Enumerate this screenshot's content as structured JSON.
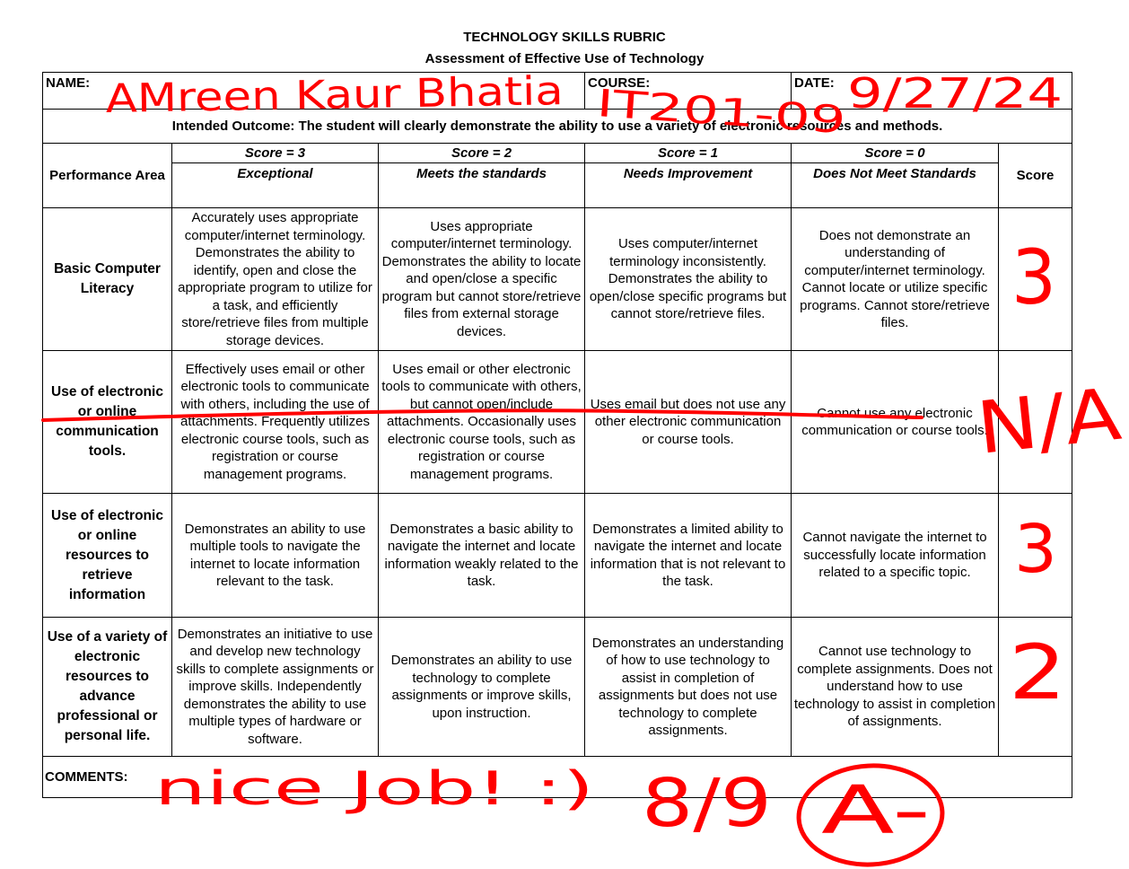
{
  "header": {
    "title": "TECHNOLOGY SKILLS RUBRIC",
    "subtitle": "Assessment of Effective Use of Technology",
    "name_label": "NAME:",
    "course_label": "COURSE:",
    "date_label": "DATE:"
  },
  "outcome": "Intended Outcome:  The student will clearly demonstrate the ability to use a variety of electronic resources and methods.",
  "columns": {
    "performance_area": "Performance Area",
    "score_header": "Score",
    "levels": [
      {
        "score": "Score = 3",
        "label": "Exceptional"
      },
      {
        "score": "Score = 2",
        "label": "Meets the standards"
      },
      {
        "score": "Score = 1",
        "label": "Needs Improvement"
      },
      {
        "score": "Score = 0",
        "label": "Does Not Meet Standards"
      }
    ]
  },
  "rows": [
    {
      "area": "Basic Computer Literacy",
      "cells": [
        "Accurately uses appropriate computer/internet terminology. Demonstrates the ability to identify, open and close the appropriate program to utilize for a task, and efficiently store/retrieve files from multiple storage devices.",
        "Uses appropriate computer/internet terminology. Demonstrates the ability to locate and open/close a specific program but cannot store/retrieve files from external storage devices.",
        "Uses computer/internet terminology inconsistently. Demonstrates the ability to open/close specific programs but cannot store/retrieve files.",
        "Does not demonstrate an understanding of computer/internet terminology. Cannot locate or utilize specific programs.  Cannot store/retrieve files."
      ]
    },
    {
      "area": "Use of electronic or online communication tools.",
      "cells": [
        "Effectively uses email or other electronic tools to communicate with others, including the use of attachments.  Frequently utilizes electronic course tools, such as registration or course management programs.",
        "Uses email or other electronic tools to communicate with others, but cannot open/include attachments.  Occasionally uses electronic course tools, such as registration or course management programs.",
        "Uses email but does not use any other electronic communication or course tools.",
        "Cannot use any electronic communication or course tools."
      ]
    },
    {
      "area": "Use of electronic or online resources to retrieve information",
      "cells": [
        "Demonstrates an ability to use multiple tools to navigate the internet to locate information relevant to the task.",
        "Demonstrates a basic ability to navigate the internet and locate information weakly related to the task.",
        "Demonstrates a limited ability to navigate the internet and locate information that is not relevant to the task.",
        "Cannot navigate the internet to successfully locate information related to a specific topic."
      ]
    },
    {
      "area": "Use of a variety of electronic resources to advance professional or personal life.",
      "cells": [
        "Demonstrates an initiative to use and develop new technology skills to complete assignments or improve skills.  Independently demonstrates the ability to use multiple types of hardware or software.",
        "Demonstrates an ability to use technology to complete assignments or improve skills, upon instruction.",
        "Demonstrates an understanding of how to use technology to assist in completion of assignments but does not use technology to complete assignments.",
        "Cannot use technology to complete assignments.  Does not understand how to use technology to assist in completion of assignments."
      ]
    }
  ],
  "comments_label": "COMMENTS:",
  "handwriting": {
    "name": "AMreen Kaur Bhatia",
    "course": "IT201-09",
    "date": "9/27/24",
    "score_row1": "3",
    "score_row2": "N/A",
    "score_row3": "3",
    "score_row4": "2",
    "comment": "nice Job! :)",
    "total": "8/9",
    "grade": "A-",
    "ink_color": "#ff0000"
  }
}
